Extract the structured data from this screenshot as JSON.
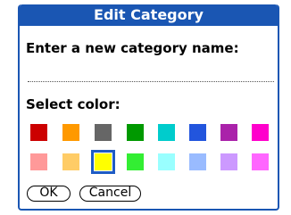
{
  "dialog": {
    "title": "Edit Category",
    "prompt": "Enter a new category name:",
    "name_value": "",
    "color_label": "Select color:"
  },
  "colors": {
    "row1": [
      "#cc0000",
      "#ff9900",
      "#666666",
      "#009900",
      "#00cccc",
      "#2255dd",
      "#aa22aa",
      "#ff00cc"
    ],
    "row2": [
      "#ff9999",
      "#ffcc66",
      "#ffff00",
      "#33ee33",
      "#99ffff",
      "#99bbff",
      "#cc99ff",
      "#ff66ff"
    ],
    "selected": "row2-3"
  },
  "buttons": {
    "ok_label": "OK",
    "cancel_label": "Cancel"
  }
}
